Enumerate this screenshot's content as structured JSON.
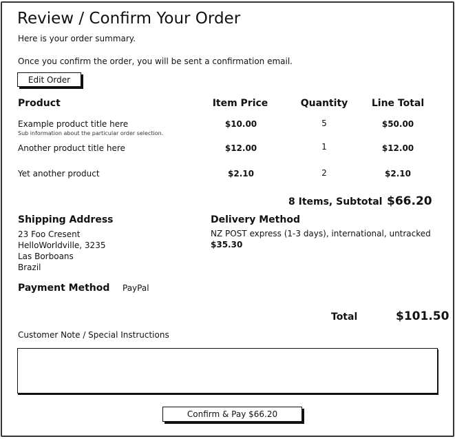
{
  "page": {
    "title": "Review / Confirm Your Order",
    "summary_text": "Here is your order summary.",
    "confirm_info": "Once you confirm the order, you will be sent a confirmation email.",
    "edit_button": "Edit Order"
  },
  "table": {
    "headers": [
      "Product",
      "Item Price",
      "Quantity",
      "Line Total"
    ],
    "rows": [
      {
        "product": "Example product title here",
        "sub": "Sub information about the particular order selection.",
        "price": "$10.00",
        "qty": "5",
        "total": "$50.00"
      },
      {
        "product": "Another product title here",
        "sub": "",
        "price": "$12.00",
        "qty": "1",
        "total": "$12.00"
      },
      {
        "product": "Yet another product",
        "sub": "",
        "price": "$2.10",
        "qty": "2",
        "total": "$2.10"
      }
    ],
    "subtotal_label": "8 Items, Subtotal",
    "subtotal_value": "$66.20"
  },
  "shipping": {
    "heading": "Shipping Address",
    "lines": [
      "23 Foo Cresent",
      "HelloWorldville, 3235",
      "Las Borboans",
      "Brazil"
    ]
  },
  "delivery": {
    "heading": "Delivery Method",
    "method": "NZ POST express (1-3 days), international, untracked",
    "price": "$35.30"
  },
  "payment": {
    "heading": "Payment Method",
    "value": "PayPal"
  },
  "totals": {
    "label": "Total",
    "value": "$101.50"
  },
  "note": {
    "label": "Customer Note / Special Instructions",
    "value": ""
  },
  "confirm_button": "Confirm & Pay $66.20"
}
